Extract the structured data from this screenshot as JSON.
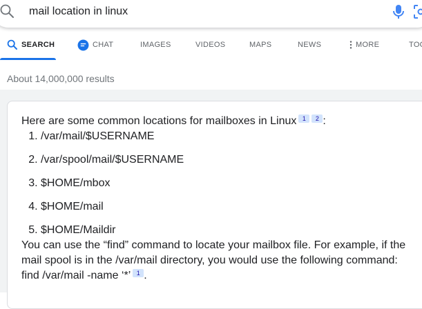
{
  "search": {
    "query": "mail location in linux"
  },
  "tabs": [
    {
      "label": "SEARCH",
      "icon": "search-icon",
      "active": true
    },
    {
      "label": "CHAT",
      "icon": "chat-icon",
      "active": false
    },
    {
      "label": "IMAGES",
      "active": false
    },
    {
      "label": "VIDEOS",
      "active": false
    },
    {
      "label": "MAPS",
      "active": false
    },
    {
      "label": "NEWS",
      "active": false
    },
    {
      "label": "MORE",
      "icon": "more-vertical-icon",
      "active": false
    },
    {
      "label": "TOO",
      "active": false
    }
  ],
  "results": {
    "count_text": "About 14,000,000 results"
  },
  "answer": {
    "intro": "Here are some common locations for mailboxes in Linux",
    "intro_citations": [
      "1",
      "2"
    ],
    "intro_suffix": ":",
    "locations": [
      "/var/mail/$USERNAME",
      "/var/spool/mail/$USERNAME",
      "$HOME/mbox",
      "$HOME/mail",
      "$HOME/Maildir"
    ],
    "tail_text": "You can use the “find” command to locate your mailbox file. For example, if the mail spool is in the /var/mail directory, you would use the following command: find /var/mail -name ‘*’",
    "tail_citation": "1",
    "tail_suffix": "."
  },
  "colors": {
    "accent": "#1a73e8",
    "link": "#1a0dab",
    "citation_bg": "#d2e3fc",
    "muted_text": "#70757a",
    "band_bg": "#f1f3f4"
  }
}
